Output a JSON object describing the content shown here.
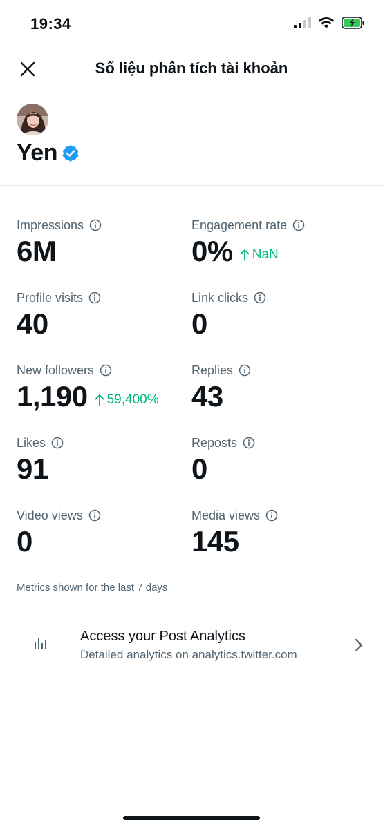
{
  "status_bar": {
    "time": "19:34"
  },
  "header": {
    "title": "Số liệu phân tích tài khoản"
  },
  "profile": {
    "name": "Yen"
  },
  "metrics": [
    {
      "label": "Impressions",
      "value": "6M",
      "change": ""
    },
    {
      "label": "Engagement rate",
      "value": "0%",
      "change": "NaN"
    },
    {
      "label": "Profile visits",
      "value": "40",
      "change": ""
    },
    {
      "label": "Link clicks",
      "value": "0",
      "change": ""
    },
    {
      "label": "New followers",
      "value": "1,190",
      "change": "59,400%"
    },
    {
      "label": "Replies",
      "value": "43",
      "change": ""
    },
    {
      "label": "Likes",
      "value": "91",
      "change": ""
    },
    {
      "label": "Reposts",
      "value": "0",
      "change": ""
    },
    {
      "label": "Video views",
      "value": "0",
      "change": ""
    },
    {
      "label": "Media views",
      "value": "145",
      "change": ""
    }
  ],
  "footnote": "Metrics shown for the last 7 days",
  "post_analytics": {
    "title": "Access your Post Analytics",
    "subtitle": "Detailed analytics on analytics.twitter.com"
  },
  "colors": {
    "text": "#0f1419",
    "secondary": "#536471",
    "positive": "#00ba7c",
    "verified": "#1d9bf0",
    "battery_charging": "#34c759"
  }
}
